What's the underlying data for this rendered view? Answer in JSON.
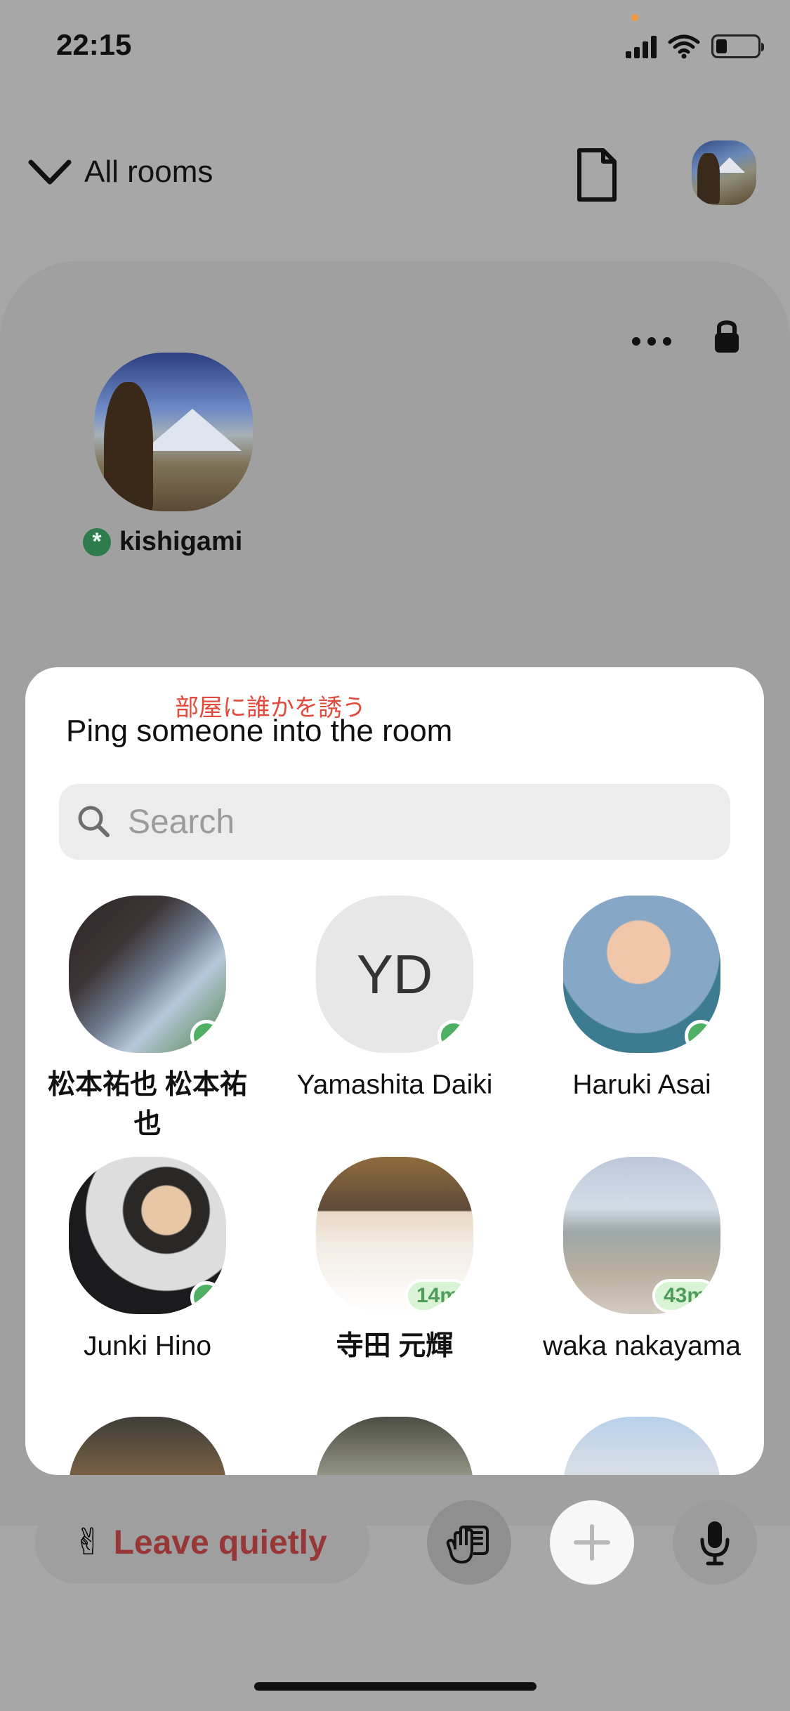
{
  "status_bar": {
    "time": "22:15"
  },
  "header": {
    "title": "All rooms"
  },
  "room": {
    "host_name": "kishigami"
  },
  "invite_sheet": {
    "annotation": "部屋に誰かを誘う",
    "title": "Ping someone into the room",
    "search": {
      "placeholder": "Search",
      "value": ""
    },
    "contacts": [
      {
        "name": "松本祐也 松本祐也",
        "status": "online"
      },
      {
        "name": "Yamashita Daiki",
        "status": "online",
        "initials": "YD"
      },
      {
        "name": "Haruki Asai",
        "status": "online"
      },
      {
        "name": "Junki Hino",
        "status": "online"
      },
      {
        "name": "寺田 元輝",
        "status": "away",
        "last_active": "14m"
      },
      {
        "name": "waka nakayama",
        "status": "away",
        "last_active": "43m"
      }
    ]
  },
  "bottom_bar": {
    "leave_label": "Leave quietly"
  },
  "icons": {
    "menu": "chevron-down-icon",
    "document": "document-icon",
    "more": "more-icon",
    "lock": "lock-icon",
    "search": "search-icon",
    "wave": "wave-icon",
    "plus": "plus-icon",
    "mic": "microphone-icon"
  },
  "colors": {
    "background": "#a7a7a7",
    "sheet": "#ffffff",
    "online": "#4faf63",
    "leave_text": "#973737",
    "annotation": "#e24a3b"
  }
}
